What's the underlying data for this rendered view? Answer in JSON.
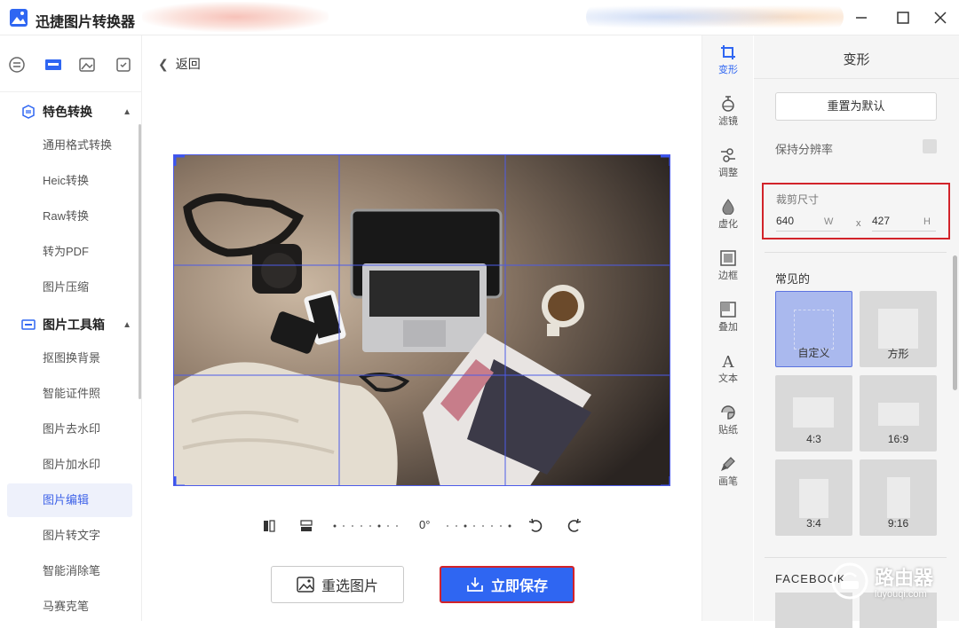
{
  "app": {
    "title": "迅捷图片转换器"
  },
  "sidebar": {
    "groups": [
      {
        "label": "特色转换",
        "items": [
          "通用格式转换",
          "Heic转换",
          "Raw转换",
          "转为PDF",
          "图片压缩"
        ]
      },
      {
        "label": "图片工具箱",
        "items": [
          "抠图换背景",
          "智能证件照",
          "图片去水印",
          "图片加水印",
          "图片编辑",
          "图片转文字",
          "智能消除笔",
          "马赛克笔"
        ]
      }
    ],
    "active_item": "图片编辑"
  },
  "main": {
    "back_label": "返回",
    "rotation": "0°",
    "reselect_label": "重选图片",
    "save_label": "立即保存"
  },
  "tools": [
    "变形",
    "滤镜",
    "调整",
    "虚化",
    "边框",
    "叠加",
    "文本",
    "贴纸",
    "画笔"
  ],
  "active_tool": "变形",
  "panel": {
    "title": "变形",
    "reset_label": "重置为默认",
    "keep_resolution_label": "保持分辨率",
    "crop": {
      "label": "裁剪尺寸",
      "width": "640",
      "width_unit": "W",
      "sep": "x",
      "height": "427",
      "height_unit": "H"
    },
    "common_label": "常见的",
    "presets": [
      "自定义",
      "方形",
      "4:3",
      "16:9",
      "3:4",
      "9:16"
    ],
    "facebook_label": "FACEBOOK"
  },
  "watermark": {
    "text": "路由器",
    "sub": "luyouqi.com"
  },
  "colors": {
    "accent": "#2f66f2",
    "highlight": "#d2232a",
    "crop_grid": "#4d5be8"
  }
}
